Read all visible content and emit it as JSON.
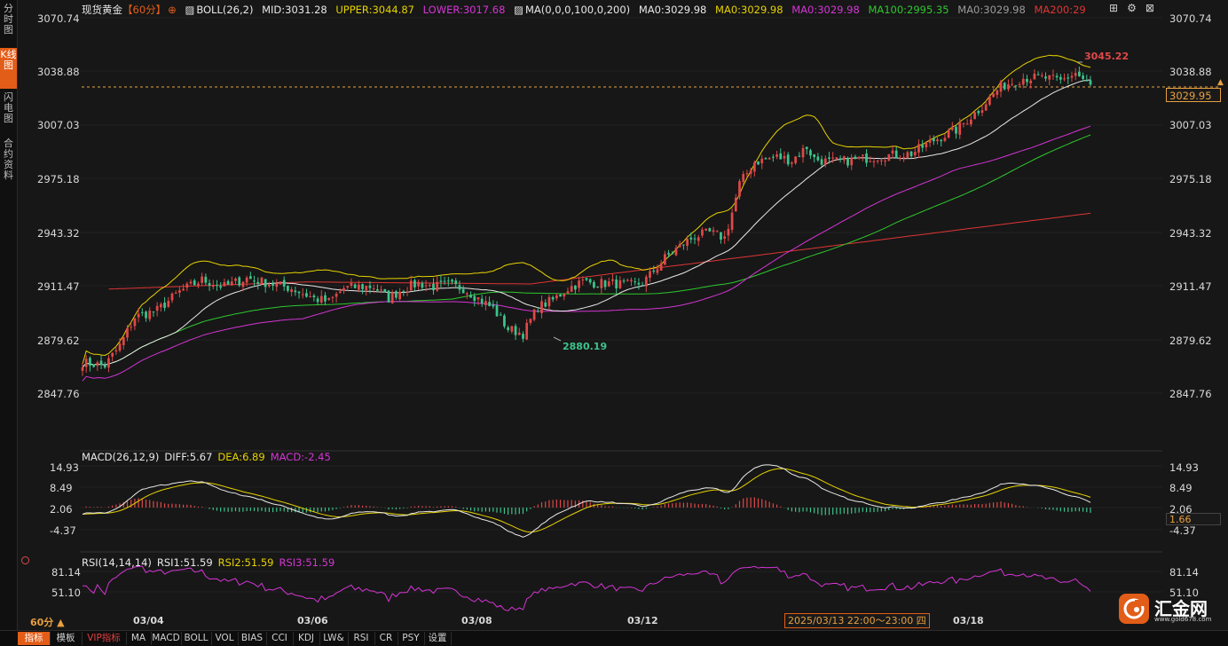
{
  "sidebar": {
    "tabs": [
      {
        "label": "分时图",
        "active": false
      },
      {
        "label": "K线图",
        "active": true
      },
      {
        "label": "闪电图",
        "active": false
      },
      {
        "label": "合约资料",
        "active": false
      }
    ]
  },
  "header": {
    "symbol": "现货黄金",
    "period": "【60分】",
    "target_icon": "crosshair-icon",
    "boll": "BOLL(26,2)",
    "mid": "MID:3031.28",
    "upper": "UPPER:3044.87",
    "lower": "LOWER:3017.68",
    "ma_label": "MA(0,0,0,100,0,200)",
    "ma_a": "MA0:3029.98",
    "ma_b": "MA0:3029.98",
    "ma_c": "MA0:3029.98",
    "ma100": "MA100:2995.35",
    "ma_d": "MA0:3029.98",
    "ma200": "MA200:29"
  },
  "window_icons": [
    "layout-icon",
    "settings-icon",
    "close-icon"
  ],
  "price_axis": {
    "left": [
      "3070.74",
      "3038.88",
      "3007.03",
      "2975.18",
      "2943.32",
      "2911.47",
      "2879.62",
      "2847.76"
    ],
    "right": [
      "3070.74",
      "3038.88",
      "3007.03",
      "2975.18",
      "2943.32",
      "2911.47",
      "2879.62",
      "2847.76"
    ],
    "current_price": "3029.95",
    "high_label": "3045.22",
    "low_label": "2880.19"
  },
  "macd": {
    "title": "MACD(26,12,9)",
    "diff": "DIFF:5.67",
    "dea": "DEA:6.89",
    "macd": "MACD:-2.45",
    "axis_left": [
      "14.93",
      "8.49",
      "2.06",
      "-4.37"
    ],
    "axis_right": [
      "14.93",
      "8.49",
      "2.06",
      "-4.37"
    ],
    "current": "1.66"
  },
  "rsi": {
    "title": "RSI(14,14,14)",
    "rsi1": "RSI1:51.59",
    "rsi2": "RSI2:51.59",
    "rsi3": "RSI3:51.59",
    "axis_left": [
      "81.14",
      "51.10"
    ],
    "axis_right": [
      "81.14",
      "51.10"
    ]
  },
  "x_axis": {
    "dates": [
      "03/04",
      "03/06",
      "03/08",
      "03/12",
      "03/18"
    ],
    "cursor_time": "2025/03/13 22:00～23:00 四",
    "period_select": "60分 ▲"
  },
  "bottom_tabs": [
    {
      "label": "指标",
      "active": true
    },
    {
      "label": "模板"
    },
    {
      "label": "VIP指标",
      "vip": true
    },
    {
      "label": "MA"
    },
    {
      "label": "MACD"
    },
    {
      "label": "BOLL"
    },
    {
      "label": "VOL"
    },
    {
      "label": "BIAS"
    },
    {
      "label": "CCI"
    },
    {
      "label": "KDJ"
    },
    {
      "label": "LW&"
    },
    {
      "label": "RSI"
    },
    {
      "label": "CR"
    },
    {
      "label": "PSY"
    },
    {
      "label": "设置"
    }
  ],
  "logo": {
    "text": "汇金网",
    "url": "www.gold678.com"
  },
  "colors": {
    "up": "#e04848",
    "down": "#3cc48c",
    "boll_upper": "#e6d200",
    "mid": "#e8e8e8",
    "lower": "#d535d5",
    "ma100": "#2ec82e",
    "ma200": "#e03535",
    "accent": "#e25d18"
  },
  "chart_data": {
    "type": "candlestick",
    "price_anchors": [
      [
        0,
        2866
      ],
      [
        6,
        2864
      ],
      [
        10,
        2876
      ],
      [
        14,
        2893
      ],
      [
        20,
        2897
      ],
      [
        26,
        2908
      ],
      [
        32,
        2915
      ],
      [
        38,
        2911
      ],
      [
        44,
        2916
      ],
      [
        50,
        2913
      ],
      [
        56,
        2910
      ],
      [
        62,
        2904
      ],
      [
        66,
        2902
      ],
      [
        70,
        2910
      ],
      [
        74,
        2911
      ],
      [
        78,
        2911
      ],
      [
        82,
        2904
      ],
      [
        86,
        2910
      ],
      [
        90,
        2913
      ],
      [
        94,
        2911
      ],
      [
        98,
        2912
      ],
      [
        102,
        2910
      ],
      [
        106,
        2904
      ],
      [
        110,
        2898
      ],
      [
        114,
        2886
      ],
      [
        118,
        2883
      ],
      [
        122,
        2899
      ],
      [
        126,
        2903
      ],
      [
        130,
        2910
      ],
      [
        134,
        2914
      ],
      [
        138,
        2913
      ],
      [
        142,
        2913
      ],
      [
        146,
        2912
      ],
      [
        150,
        2913
      ],
      [
        152,
        2918
      ],
      [
        156,
        2928
      ],
      [
        160,
        2935
      ],
      [
        164,
        2941
      ],
      [
        168,
        2943
      ],
      [
        172,
        2940
      ],
      [
        174,
        2955
      ],
      [
        176,
        2972
      ],
      [
        180,
        2985
      ],
      [
        186,
        2988
      ],
      [
        190,
        2986
      ],
      [
        194,
        2994
      ],
      [
        196,
        2987
      ],
      [
        200,
        2985
      ],
      [
        206,
        2986
      ],
      [
        212,
        2988
      ],
      [
        216,
        2989
      ],
      [
        222,
        2990
      ],
      [
        228,
        2998
      ],
      [
        234,
        3004
      ],
      [
        240,
        3016
      ],
      [
        246,
        3030
      ],
      [
        252,
        3035
      ],
      [
        258,
        3035
      ],
      [
        262,
        3033
      ],
      [
        266,
        3038
      ],
      [
        270,
        3030
      ]
    ],
    "bars": 271,
    "x_dates": [
      "03/04",
      "03/06",
      "03/08",
      "03/12",
      "03/18"
    ]
  }
}
